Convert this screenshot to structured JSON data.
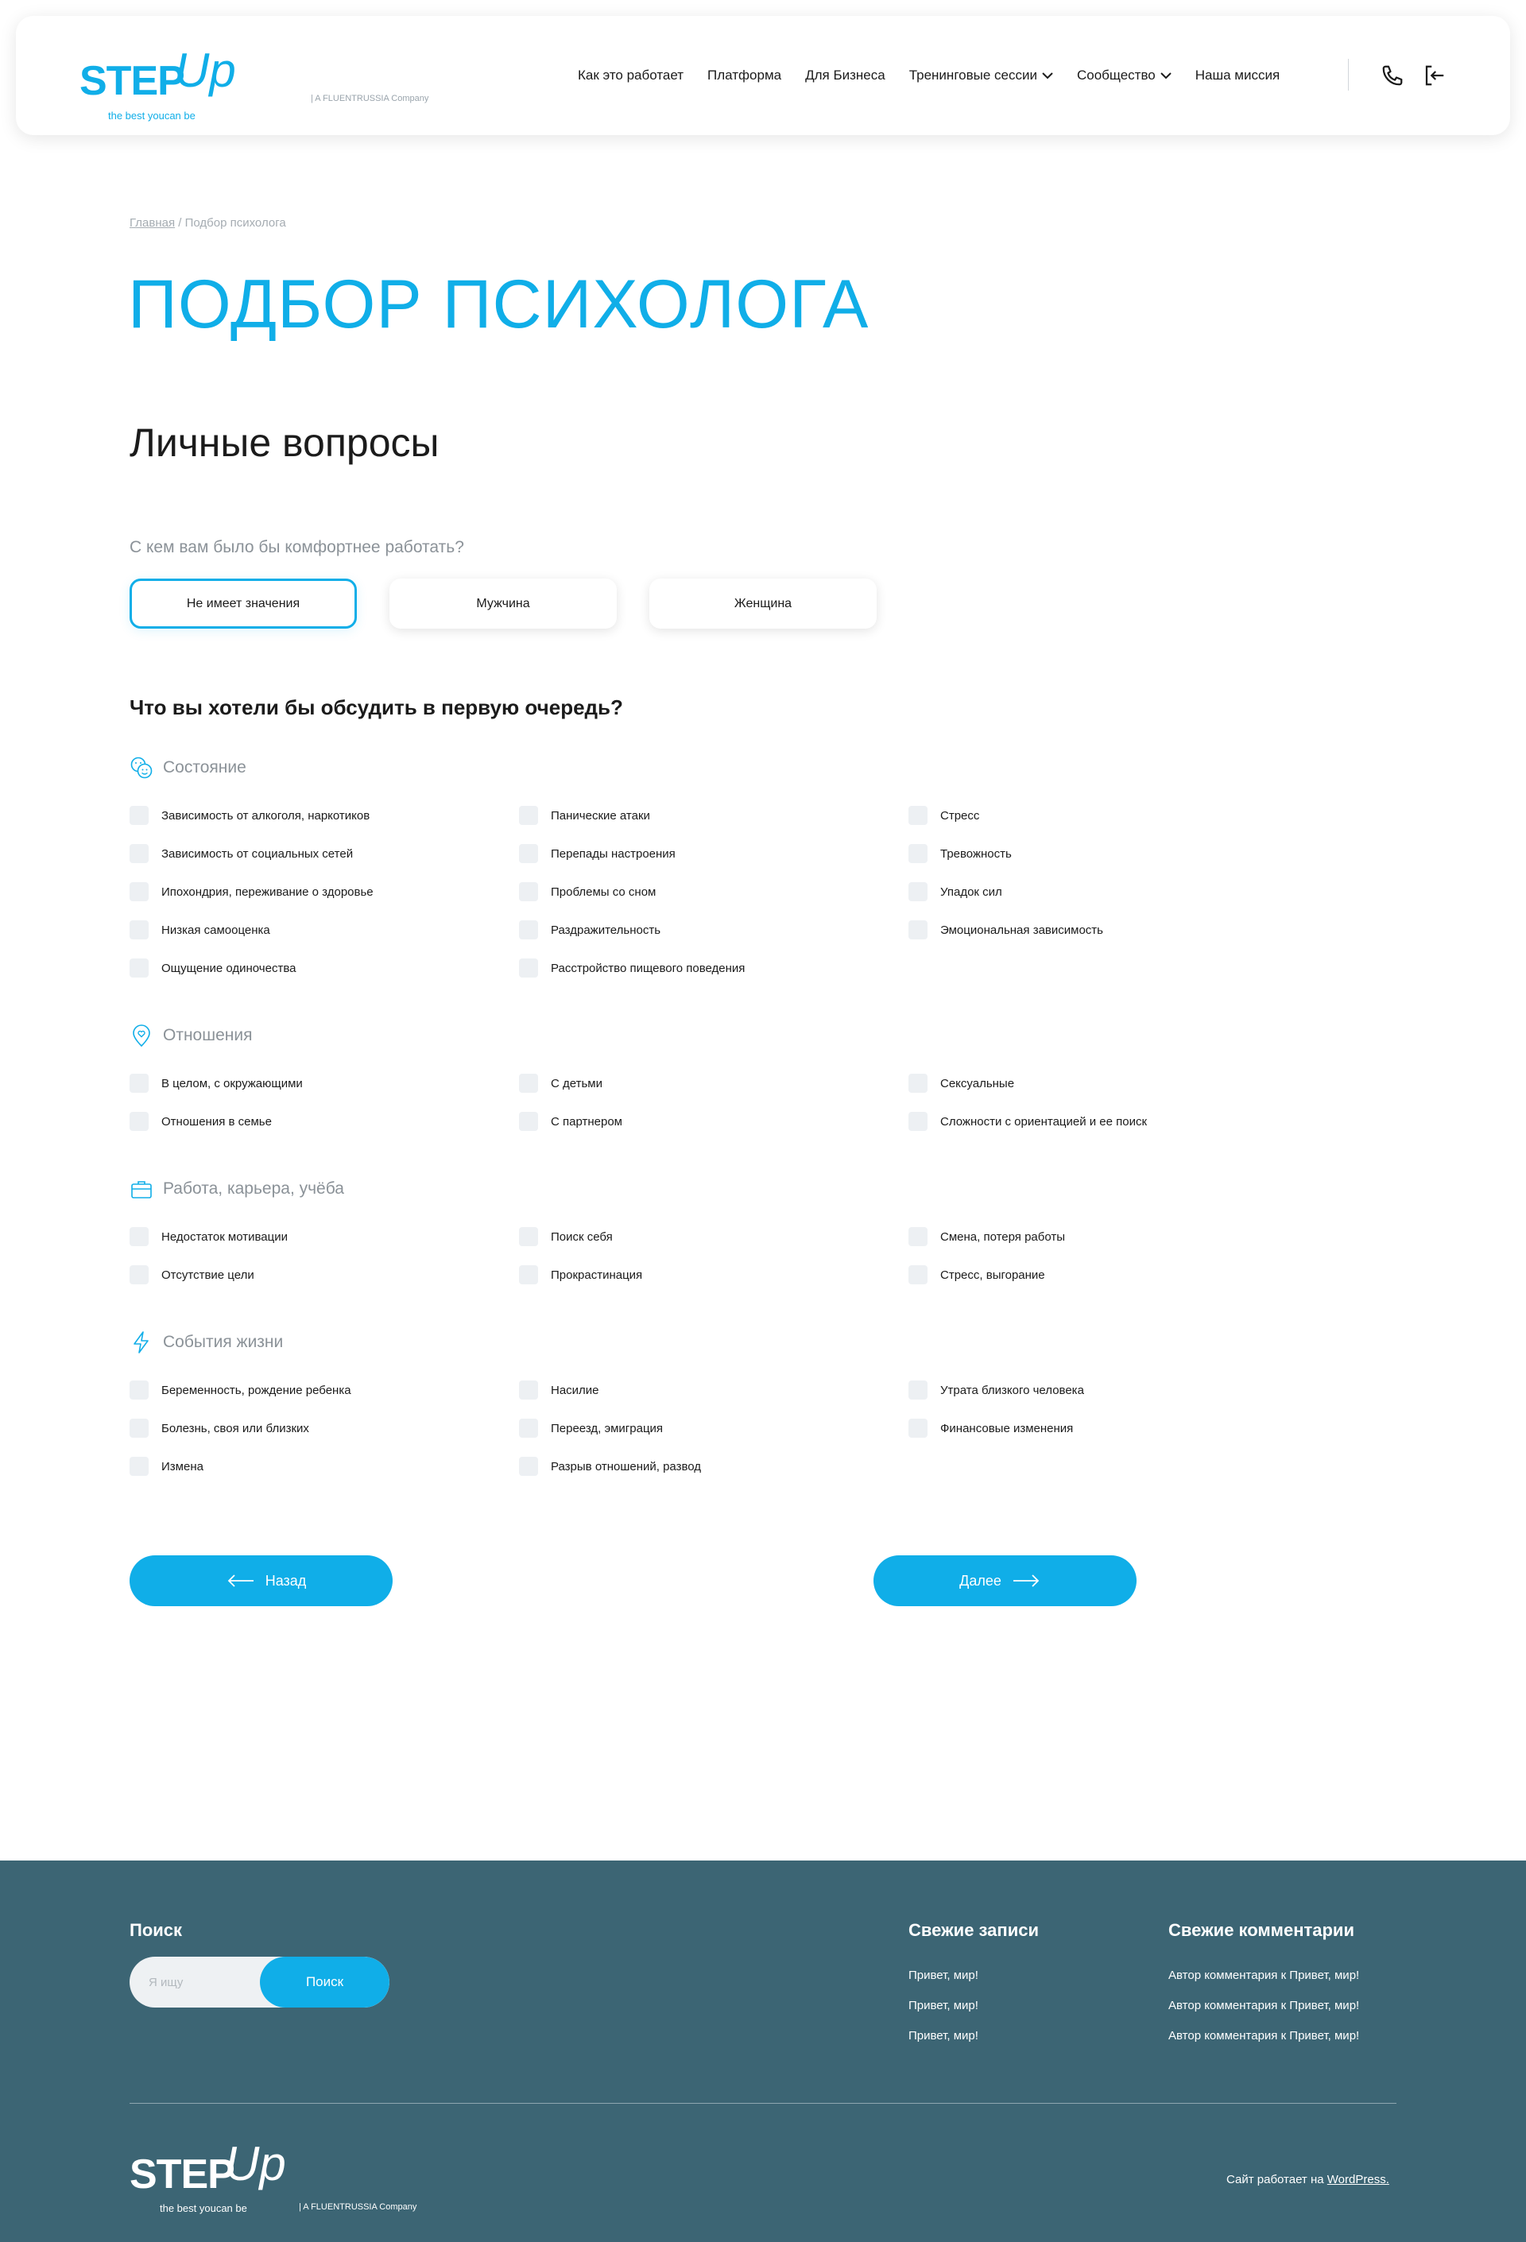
{
  "header": {
    "logo": {
      "step": "STEP",
      "up": "Up",
      "tagline": "the best youcan be",
      "company": "| A FLUENTRUSSIA Company"
    },
    "nav": [
      {
        "label": "Как это работает"
      },
      {
        "label": "Платформа"
      },
      {
        "label": "Для Бизнеса"
      },
      {
        "label": "Тренинговые сессии"
      },
      {
        "label": "Сообщество"
      },
      {
        "label": "Наша миссия"
      }
    ]
  },
  "breadcrumb": {
    "home": "Главная",
    "separator": " / ",
    "current": "Подбор психолога"
  },
  "page_title": "ПОДБОР ПСИХОЛОГА",
  "section_title": "Личные вопросы",
  "gender": {
    "question": "С кем вам было бы комфортнее работать?",
    "options": [
      "Не имеет значения",
      "Мужчина",
      "Женщина"
    ],
    "selected": "Не имеет значения"
  },
  "topics": {
    "question": "Что вы хотели бы обсудить в первую очередь?",
    "categories": [
      {
        "title": "Состояние",
        "icon": "smiley-faces-icon",
        "items": [
          "Зависимость от алкоголя, наркотиков",
          "Панические атаки",
          "Стресс",
          "Зависимость от социальных сетей",
          "Перепады настроения",
          "Тревожность",
          "Ипохондрия, переживание о здоровье",
          "Проблемы со сном",
          "Упадок сил",
          "Низкая самооценка",
          "Раздражительность",
          "Эмоциональная зависимость",
          "Ощущение одиночества",
          "Расстройство пищевого поведения"
        ]
      },
      {
        "title": "Отношения",
        "icon": "location-heart-icon",
        "items": [
          "В целом, с окружающими",
          "С детьми",
          "Сексуальные",
          "Отношения в семье",
          "С партнером",
          "Сложности с ориентацией и ее поиск"
        ]
      },
      {
        "title": "Работа, карьера, учёба",
        "icon": "briefcase-icon",
        "items": [
          "Недостаток мотивации",
          "Поиск себя",
          "Смена, потеря работы",
          "Отсутствие цели",
          "Прокрастинация",
          "Стресс, выгорание"
        ]
      },
      {
        "title": "События жизни",
        "icon": "lightning-icon",
        "items": [
          "Беременность, рождение ребенка",
          "Насилие",
          "Утрата близкого человека",
          "Болезнь, своя или близких",
          "Переезд, эмиграция",
          "Финансовые изменения",
          "Измена",
          "Разрыв отношений, развод"
        ]
      }
    ]
  },
  "buttons": {
    "back": "Назад",
    "next": "Далее"
  },
  "footer": {
    "search_title": "Поиск",
    "search_placeholder": "Я ищу",
    "search_button": "Поиск",
    "recent_posts_title": "Свежие записи",
    "recent_posts": [
      "Привет, мир!",
      "Привет, мир!",
      "Привет, мир!"
    ],
    "recent_comments_title": "Свежие комментарии",
    "recent_comments": [
      "Автор комментария к Привет, мир!",
      "Автор комментария к Привет, мир!",
      "Автор комментария к Привет, мир!"
    ],
    "logo": {
      "step": "STEP",
      "up": "Up",
      "tagline": "the best youcan be",
      "company": "| A FLUENTRUSSIA Company"
    },
    "powered_prefix": "Сайт работает на ",
    "powered_link": "WordPress."
  },
  "colors": {
    "accent": "#10aee8",
    "footer_bg": "#3c6574",
    "checkbox_bg": "#edf0f3",
    "muted_text": "#8b9298"
  }
}
